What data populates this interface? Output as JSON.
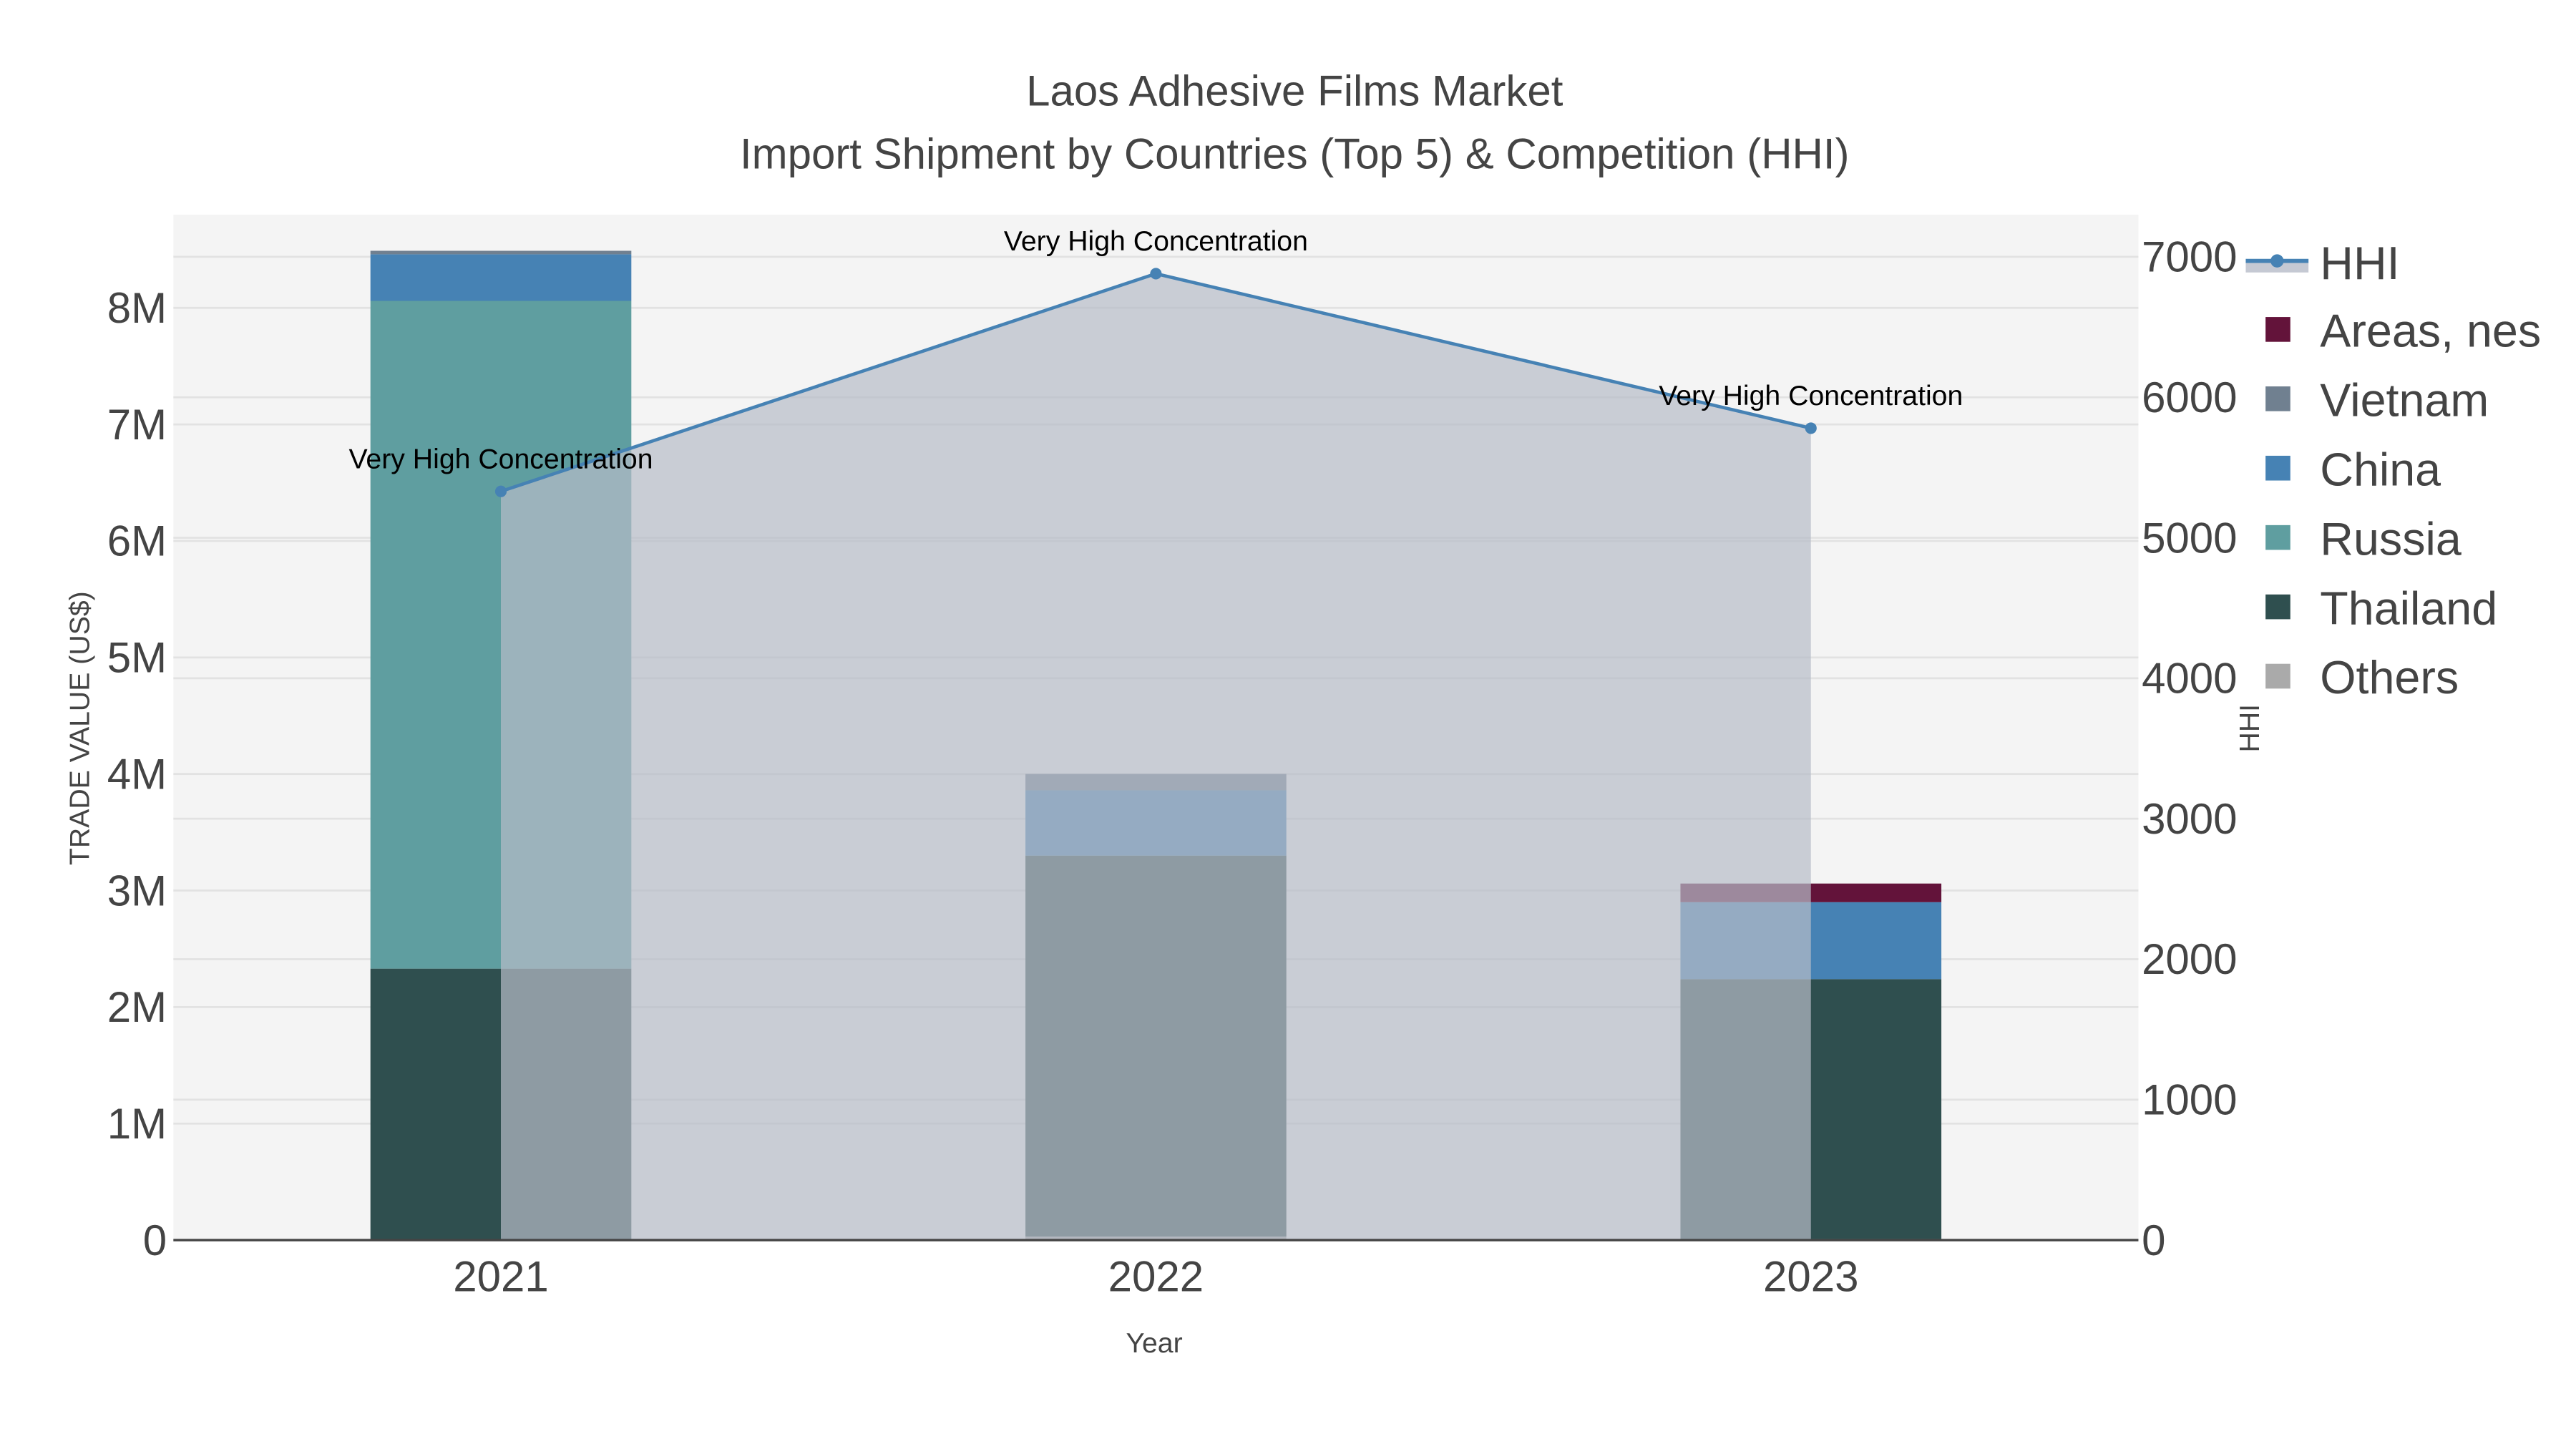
{
  "chart_data": {
    "type": "bar",
    "title": "Laos Adhesive Films Market",
    "subtitle": "Import Shipment by Countries (Top 5) & Competition (HHI)",
    "xlabel": "Year",
    "ylabel": "TRADE VALUE (US$)",
    "y2label": "HHI",
    "categories": [
      "2021",
      "2022",
      "2023"
    ],
    "ylim": [
      0,
      8800000
    ],
    "y2lim": [
      0,
      7300
    ],
    "yticks": [
      {
        "v": 0,
        "label": "0"
      },
      {
        "v": 1000000,
        "label": "1M"
      },
      {
        "v": 2000000,
        "label": "2M"
      },
      {
        "v": 3000000,
        "label": "3M"
      },
      {
        "v": 4000000,
        "label": "4M"
      },
      {
        "v": 5000000,
        "label": "5M"
      },
      {
        "v": 6000000,
        "label": "6M"
      },
      {
        "v": 7000000,
        "label": "7M"
      },
      {
        "v": 8000000,
        "label": "8M"
      }
    ],
    "y2ticks": [
      {
        "v": 0,
        "label": "0"
      },
      {
        "v": 1000,
        "label": "1000"
      },
      {
        "v": 2000,
        "label": "2000"
      },
      {
        "v": 3000,
        "label": "3000"
      },
      {
        "v": 4000,
        "label": "4000"
      },
      {
        "v": 5000,
        "label": "5000"
      },
      {
        "v": 6000,
        "label": "6000"
      },
      {
        "v": 7000,
        "label": "7000"
      }
    ],
    "stack_order": [
      "Others",
      "Thailand",
      "Russia",
      "China",
      "Vietnam",
      "Areas, nes"
    ],
    "series": [
      {
        "name": "Areas, nes",
        "color": "#63133a",
        "values": [
          0,
          0,
          160000
        ]
      },
      {
        "name": "Vietnam",
        "color": "#708090",
        "values": [
          30000,
          140000,
          0
        ]
      },
      {
        "name": "China",
        "color": "#4682b4",
        "values": [
          400000,
          560000,
          660000
        ]
      },
      {
        "name": "Russia",
        "color": "#5f9ea0",
        "values": [
          5730000,
          0,
          0
        ]
      },
      {
        "name": "Thailand",
        "color": "#2f4f4f",
        "values": [
          2330000,
          3270000,
          2230000
        ]
      },
      {
        "name": "Others",
        "color": "#aaaaaa",
        "values": [
          0,
          30000,
          10000
        ]
      }
    ],
    "hhi": {
      "name": "HHI",
      "color": "#4682b4",
      "values": [
        5330,
        6880,
        5780
      ],
      "labels": [
        "Very High Concentration",
        "Very High Concentration",
        "Very High Concentration"
      ]
    },
    "legend_position": "right"
  }
}
